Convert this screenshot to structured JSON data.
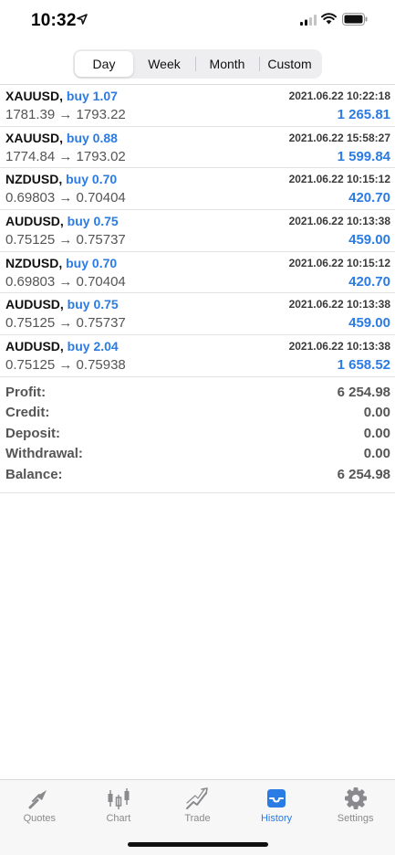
{
  "status_bar": {
    "time": "10:32"
  },
  "period_tabs": [
    {
      "label": "Day",
      "active": true
    },
    {
      "label": "Week",
      "active": false
    },
    {
      "label": "Month",
      "active": false
    },
    {
      "label": "Custom",
      "active": false
    }
  ],
  "deals": [
    {
      "symbol": "XAUUSD,",
      "side": "buy 1.07",
      "date": "2021.06.22 10:22:18",
      "prices": "1781.39 → 1793.22",
      "profit": "1 265.81"
    },
    {
      "symbol": "XAUUSD,",
      "side": "buy 0.88",
      "date": "2021.06.22 15:58:27",
      "prices": "1774.84 → 1793.02",
      "profit": "1 599.84"
    },
    {
      "symbol": "NZDUSD,",
      "side": "buy 0.70",
      "date": "2021.06.22 10:15:12",
      "prices": "0.69803 → 0.70404",
      "profit": "420.70"
    },
    {
      "symbol": "AUDUSD,",
      "side": "buy 0.75",
      "date": "2021.06.22 10:13:38",
      "prices": "0.75125 → 0.75737",
      "profit": "459.00"
    },
    {
      "symbol": "NZDUSD,",
      "side": "buy 0.70",
      "date": "2021.06.22 10:15:12",
      "prices": "0.69803 → 0.70404",
      "profit": "420.70"
    },
    {
      "symbol": "AUDUSD,",
      "side": "buy 0.75",
      "date": "2021.06.22 10:13:38",
      "prices": "0.75125 → 0.75737",
      "profit": "459.00"
    },
    {
      "symbol": "AUDUSD,",
      "side": "buy 2.04",
      "date": "2021.06.22 10:13:38",
      "prices": "0.75125 → 0.75938",
      "profit": "1 658.52"
    }
  ],
  "summary": [
    {
      "label": "Profit:",
      "value": "6 254.98"
    },
    {
      "label": "Credit:",
      "value": "0.00"
    },
    {
      "label": "Deposit:",
      "value": "0.00"
    },
    {
      "label": "Withdrawal:",
      "value": "0.00"
    },
    {
      "label": "Balance:",
      "value": "6 254.98"
    }
  ],
  "tab_bar": [
    {
      "label": "Quotes",
      "icon": "quotes-icon",
      "active": false
    },
    {
      "label": "Chart",
      "icon": "candlestick-chart-icon",
      "active": false
    },
    {
      "label": "Trade",
      "icon": "trade-icon",
      "active": false
    },
    {
      "label": "History",
      "icon": "inbox-tray-icon",
      "active": true
    },
    {
      "label": "Settings",
      "icon": "gear-icon",
      "active": false
    }
  ],
  "colors": {
    "accent": "#2b7be4",
    "inactive_gray": "#8a8a8e",
    "text_secondary": "#555555"
  }
}
